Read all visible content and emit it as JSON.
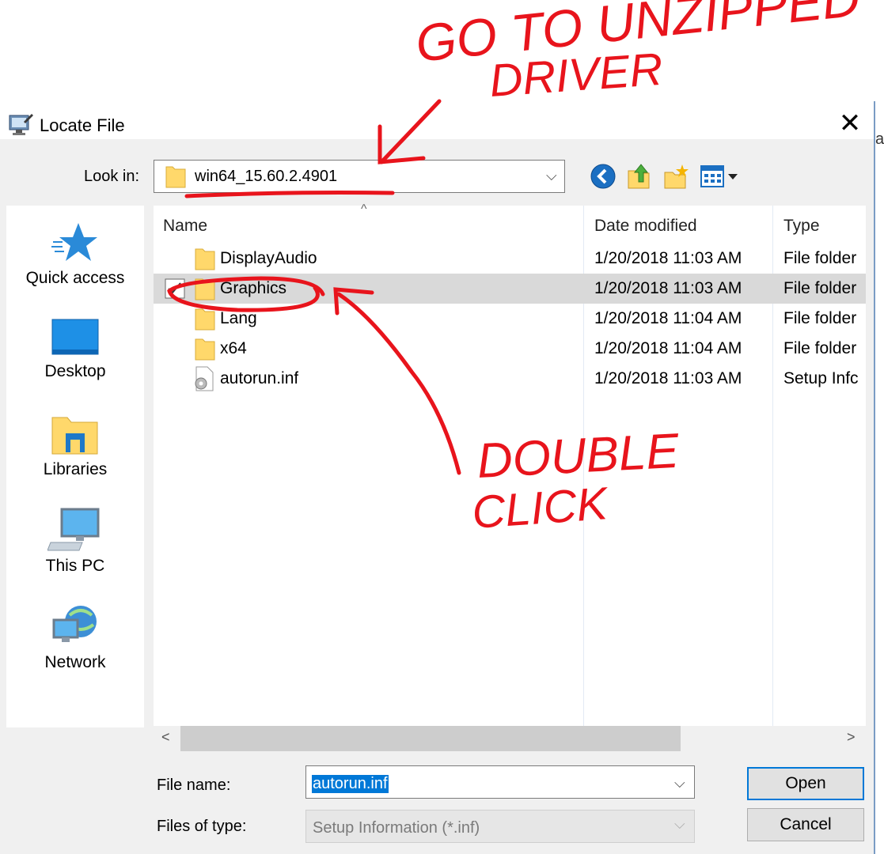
{
  "window": {
    "title": "Locate File",
    "close_glyph": "✕",
    "partial_right_text": "a"
  },
  "look_in": {
    "label": "Look in:",
    "value": "win64_15.60.2.4901",
    "chevron": "⌵"
  },
  "toolbar": {
    "icons": [
      "back-icon",
      "up-folder-icon",
      "new-folder-icon",
      "view-menu-icon"
    ]
  },
  "places": [
    {
      "label": "Quick access",
      "icon": "star-icon"
    },
    {
      "label": "Desktop",
      "icon": "desktop-icon"
    },
    {
      "label": "Libraries",
      "icon": "libraries-icon"
    },
    {
      "label": "This PC",
      "icon": "computer-icon"
    },
    {
      "label": "Network",
      "icon": "network-icon"
    }
  ],
  "columns": {
    "name": "Name",
    "date": "Date modified",
    "type": "Type",
    "sort_glyph": "^"
  },
  "files": [
    {
      "name": "DisplayAudio",
      "date": "1/20/2018 11:03 AM",
      "type": "File folder",
      "icon": "folder-icon"
    },
    {
      "name": "Graphics",
      "date": "1/20/2018 11:03 AM",
      "type": "File folder",
      "icon": "folder-icon"
    },
    {
      "name": "Lang",
      "date": "1/20/2018 11:04 AM",
      "type": "File folder",
      "icon": "folder-icon"
    },
    {
      "name": "x64",
      "date": "1/20/2018 11:04 AM",
      "type": "File folder",
      "icon": "folder-icon"
    },
    {
      "name": "autorun.inf",
      "date": "1/20/2018 11:03 AM",
      "type": "Setup Infc",
      "icon": "settings-file-icon"
    }
  ],
  "scroll": {
    "left": "<",
    "right": ">"
  },
  "file_name": {
    "label": "File name:",
    "value": "autorun.inf"
  },
  "files_of_type": {
    "label": "Files of type:",
    "value": "Setup Information (*.inf)"
  },
  "buttons": {
    "open": "Open",
    "cancel": "Cancel"
  },
  "annotations": {
    "top_line1": "GO TO UNZIPPED",
    "top_line2": "DRIVER",
    "mid_line1": "DOUBLE",
    "mid_line2": "CLICK",
    "ink_color": "#e8141c"
  },
  "colors": {
    "selection": "#0078d7",
    "folder": "#ffd86b",
    "selected_row": "#d9d9d9"
  }
}
